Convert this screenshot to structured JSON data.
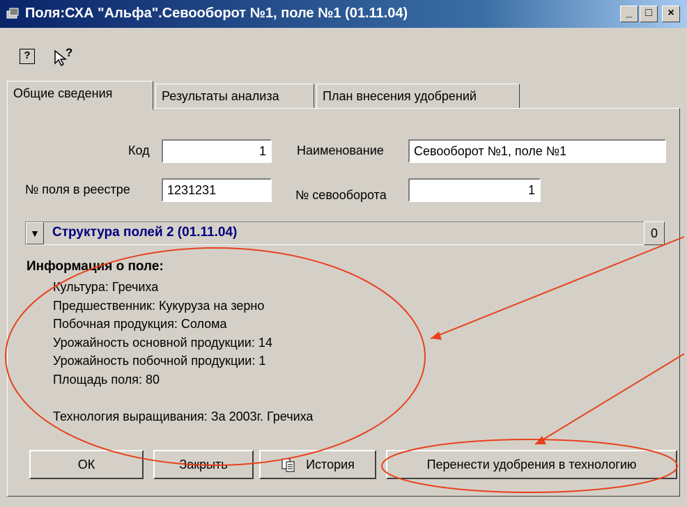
{
  "window": {
    "title": "Поля:СХА \"Альфа\".Севооборот №1, поле №1 (01.11.04)",
    "min_label": "_",
    "max_label": "□",
    "close_label": "×"
  },
  "toolbar": {
    "help_icon": "help-icon",
    "whats_this_icon": "whats-this-icon",
    "help_glyph": "?",
    "whats_this_glyph": "?"
  },
  "tabs": [
    "Общие сведения",
    "Результаты анализа",
    "План внесения удобрений"
  ],
  "form": {
    "code_label": "Код",
    "code_value": "1",
    "name_label": "Наименование",
    "name_value": "Севооборот №1, поле №1",
    "registry_label": "№ поля в реестре",
    "registry_value": "1231231",
    "rotation_label": "№ севооборота",
    "rotation_value": "1"
  },
  "structure": {
    "drop_glyph": "▼",
    "label": "Структура полей 2 (01.11.04)",
    "button": "0"
  },
  "info": {
    "heading": "Информация о поле:",
    "lines": [
      "Культура: Гречиха",
      "Предшественник: Кукуруза на зерно",
      "Побочная продукция: Солома",
      "Урожайность основной продукции: 14",
      "Урожайность побочной продукции: 1",
      "Площадь поля: 80"
    ],
    "technology": "Технология выращивания: За 2003г. Гречиха"
  },
  "buttons": {
    "ok": "ОК",
    "close": "Закрыть",
    "history": "История",
    "transfer": "Перенести удобрения в технологию"
  },
  "annotation_color": "#e8401c"
}
